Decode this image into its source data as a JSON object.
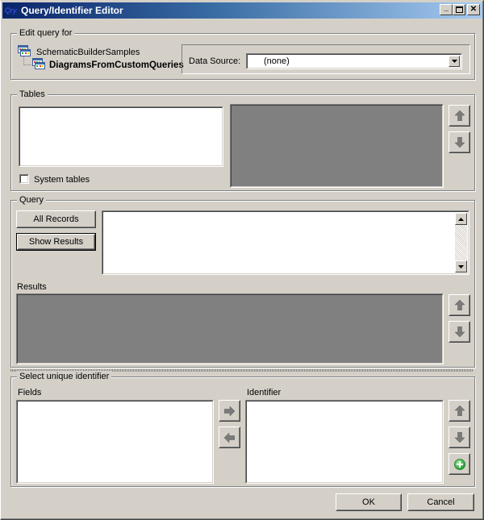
{
  "window": {
    "title": "Query/Identifier Editor",
    "icon_text": "Qry",
    "controls": {
      "minimize": "_",
      "maximize": "□",
      "close": "✕"
    }
  },
  "edit_query": {
    "legend": "Edit query for",
    "tree": {
      "parent": {
        "label": "SchematicBuilderSamples",
        "icon": "dataset-icon"
      },
      "child": {
        "label": "DiagramsFromCustomQueries",
        "icon": "dataset-icon"
      }
    },
    "data_source": {
      "label": "Data Source:",
      "value": "(none)"
    }
  },
  "tables": {
    "legend": "Tables",
    "system_tables": {
      "label": "System tables",
      "checked": false
    },
    "buttons": {
      "up": "arrow-up-icon",
      "down": "arrow-down-icon"
    }
  },
  "query": {
    "legend": "Query",
    "all_records_label": "All Records",
    "show_results_label": "Show Results",
    "query_text": "",
    "results_label": "Results"
  },
  "identifier": {
    "legend": "Select unique identifier",
    "fields_label": "Fields",
    "identifier_label": "Identifier"
  },
  "footer": {
    "ok_label": "OK",
    "cancel_label": "Cancel"
  },
  "colors": {
    "title_start": "#0a246a",
    "title_end": "#a6caf0",
    "face": "#d4d0c8",
    "grid_empty": "#808080",
    "add_green": "#3cb043"
  }
}
